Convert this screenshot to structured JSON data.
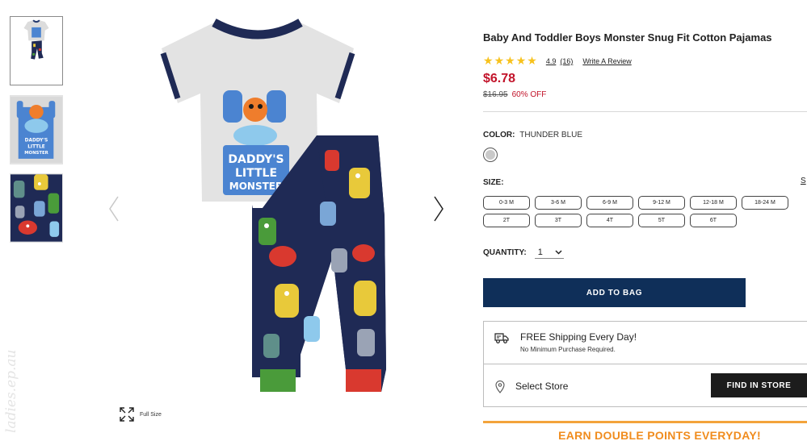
{
  "product": {
    "title": "Baby And Toddler Boys Monster Snug Fit Cotton Pajamas",
    "rating_value": "4.9",
    "rating_count": "(16)",
    "rating_stars": 5,
    "write_review_label": "Write A Review",
    "price": "$6.78",
    "original_price": "$16.95",
    "discount": "60% OFF"
  },
  "gallery": {
    "thumbnails": [
      "thumbnail-full-outfit",
      "thumbnail-shirt-graphic",
      "thumbnail-pants-print"
    ],
    "shirt_graphic_lines": [
      "DADDY'S",
      "LITTLE",
      "MONSTER"
    ],
    "full_size_label": "Full Size",
    "watermark_text": "ladies.ep.au"
  },
  "color": {
    "label": "COLOR:",
    "value": "THUNDER BLUE"
  },
  "size": {
    "label": "SIZE:",
    "guide_label": "S",
    "options": [
      "0-3 M",
      "3-6 M",
      "6-9 M",
      "9-12 M",
      "12-18 M",
      "18-24 M",
      "2T",
      "3T",
      "4T",
      "5T",
      "6T"
    ]
  },
  "quantity": {
    "label": "QUANTITY:",
    "value": "1"
  },
  "actions": {
    "add_to_bag": "ADD TO BAG",
    "find_in_store": "FIND IN STORE"
  },
  "shipping": {
    "title": "FREE Shipping Every Day!",
    "subtitle": "No Minimum Purchase Required.",
    "select_store": "Select Store"
  },
  "promo": {
    "points_text": "EARN DOUBLE POINTS EVERYDAY!"
  },
  "icons": {
    "previous_arrow": "chevron-left-icon",
    "next_arrow": "chevron-right-icon",
    "full_size": "expand-icon",
    "shipping": "truck-icon",
    "store": "map-pin-icon",
    "quantity_dropdown": "chevron-down-icon",
    "rating": "star-icon"
  },
  "colors": {
    "price_red": "#c2132a",
    "star_gold": "#f7c21d",
    "add_to_bag_navy": "#0f2f59",
    "find_button": "#1c1c1c",
    "promo_orange": "#f08c1e"
  }
}
